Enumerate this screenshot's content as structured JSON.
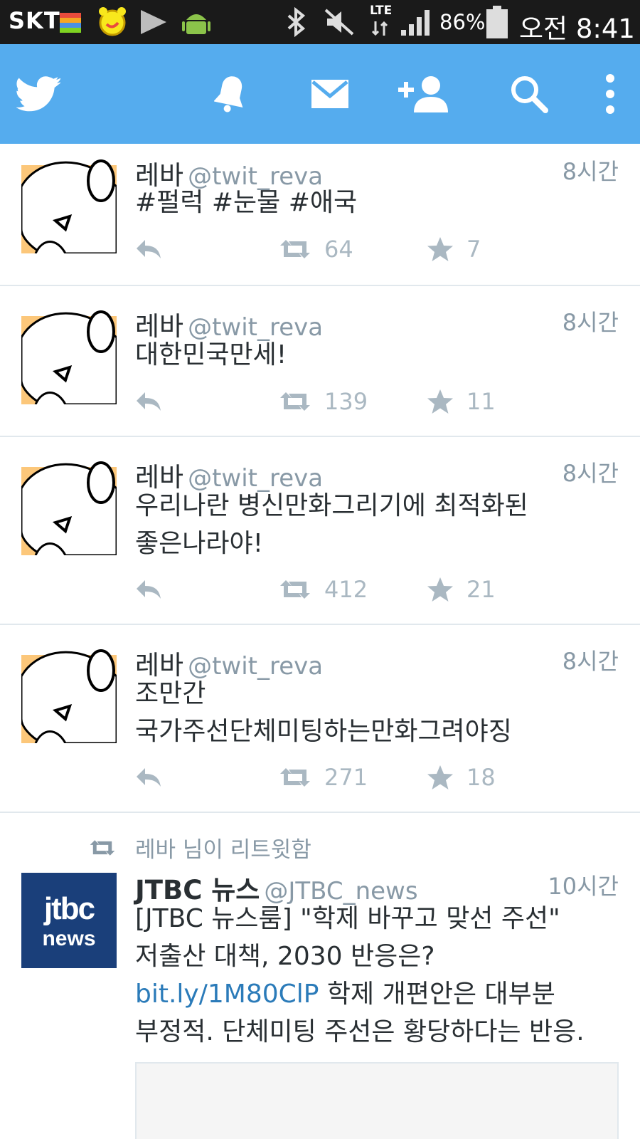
{
  "status_bar": {
    "carrier": "SKT",
    "battery": "86%",
    "time": "오전 8:41",
    "network": "LTE"
  },
  "app_bar": {
    "icons": [
      "twitter-bird-icon",
      "notifications-bell-icon",
      "messages-envelope-icon",
      "add-user-icon",
      "search-icon",
      "overflow-menu-icon"
    ],
    "brand_color": "#55acee"
  },
  "tweets": [
    {
      "name": "레바",
      "handle": "@twit_reva",
      "time": "8시간",
      "text": "#펄럭  #눈물  #애국",
      "retweets": "64",
      "likes": "7"
    },
    {
      "name": "레바",
      "handle": "@twit_reva",
      "time": "8시간",
      "text": "대한민국만세!",
      "retweets": "139",
      "likes": "11"
    },
    {
      "name": "레바",
      "handle": "@twit_reva",
      "time": "8시간",
      "text_line1": "우리나란 병신만화그리기에 최적화된",
      "text_line2": "좋은나라야!",
      "retweets": "412",
      "likes": "21"
    },
    {
      "name": "레바",
      "handle": "@twit_reva",
      "time": "8시간",
      "text_line1": "조만간",
      "text_line2": "국가주선단체미팅하는만화그려야징",
      "retweets": "271",
      "likes": "18"
    }
  ],
  "retweeted_tweet": {
    "retweet_label": "레바 님이 리트윗함",
    "name": "JTBC 뉴스",
    "handle": "@JTBC_news",
    "time": "10시간",
    "line1": "[JTBC 뉴스룸] \"학제 바꾸고 맞선 주선\"",
    "line2": "저출산 대책, 2030 반응은?",
    "link": "bit.ly/1M80ClP",
    "line3_rest": " 학제 개편안은 대부분",
    "line4": "부정적. 단체미팅 주선은 황당하다는 반응.",
    "avatar_text_top": "jtbc",
    "avatar_text_bottom": "news"
  }
}
